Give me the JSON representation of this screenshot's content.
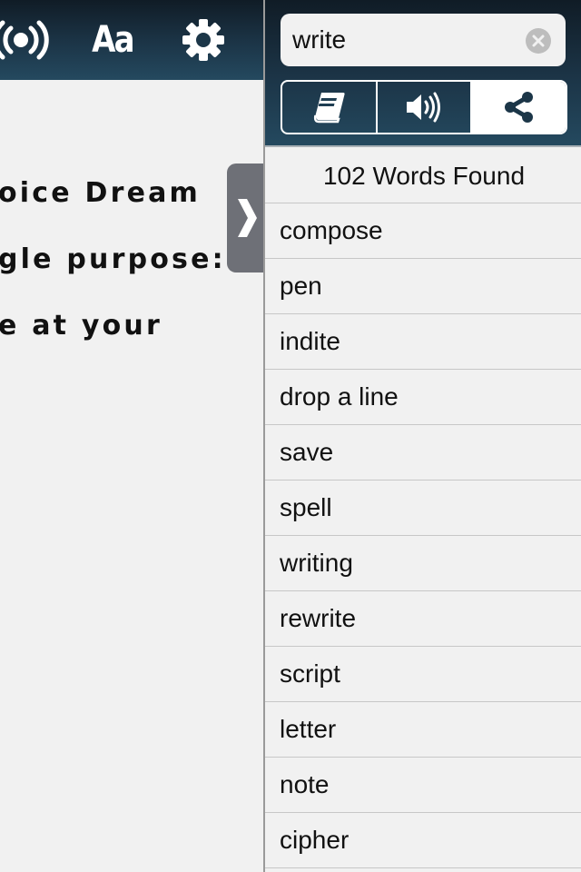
{
  "left_toolbar": {
    "icons": [
      "broadcast-icon",
      "font-size-icon",
      "gear-icon"
    ],
    "font_label": "Aa"
  },
  "reader": {
    "lines": [
      "oice Dream",
      "gle purpose:",
      "e at your"
    ]
  },
  "drawer_handle": {
    "icon": "chevron-right-icon",
    "glyph": "❯"
  },
  "search": {
    "value": "write",
    "placeholder": "Search"
  },
  "segments": [
    {
      "name": "dictionary",
      "icon": "book-icon",
      "active": false
    },
    {
      "name": "speak",
      "icon": "speaker-icon",
      "active": false
    },
    {
      "name": "share",
      "icon": "share-icon",
      "active": true
    }
  ],
  "results": {
    "header": "102 Words Found",
    "count": 102,
    "words": [
      "compose",
      "pen",
      "indite",
      "drop a line",
      "save",
      "spell",
      "writing",
      "rewrite",
      "script",
      "letter",
      "note",
      "cipher"
    ]
  },
  "colors": {
    "toolbar_top": "#101c26",
    "toolbar_bottom": "#24495f",
    "background": "#f1f1f1",
    "handle": "#6e7077"
  }
}
